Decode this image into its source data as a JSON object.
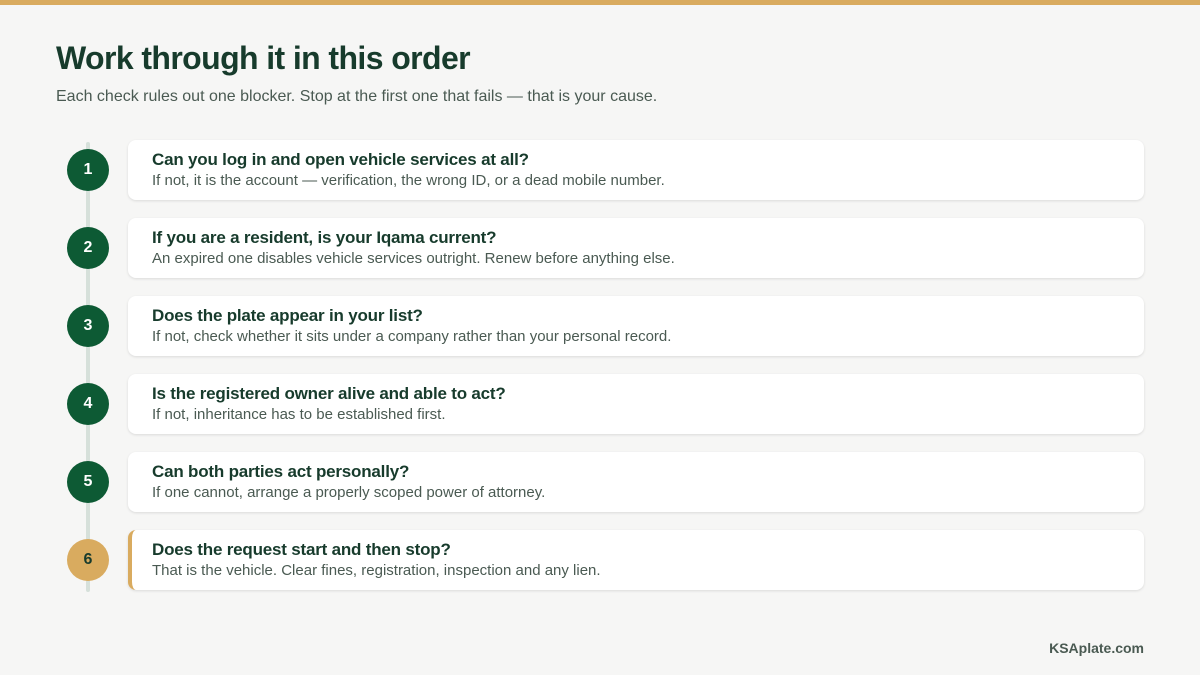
{
  "title": "Work through it in this order",
  "subtitle": "Each check rules out one blocker. Stop at the first one that fails — that is your cause.",
  "steps": [
    {
      "number": "1",
      "question": "Can you log in and open vehicle services at all?",
      "detail": "If not, it is the account — verification, the wrong ID, or a dead mobile number."
    },
    {
      "number": "2",
      "question": "If you are a resident, is your Iqama current?",
      "detail": "An expired one disables vehicle services outright. Renew before anything else."
    },
    {
      "number": "3",
      "question": "Does the plate appear in your list?",
      "detail": "If not, check whether it sits under a company rather than your personal record."
    },
    {
      "number": "4",
      "question": "Is the registered owner alive and able to act?",
      "detail": "If not, inheritance has to be established first."
    },
    {
      "number": "5",
      "question": "Can both parties act personally?",
      "detail": "If one cannot, arrange a properly scoped power of attorney."
    },
    {
      "number": "6",
      "question": "Does the request start and then stop?",
      "detail": "That is the vehicle. Clear fines, registration, inspection and any lien."
    }
  ],
  "brand": "KSAplate.com",
  "colors": {
    "accent": "#d9ab5f",
    "primary": "#0d5a34",
    "heading": "#173b2c",
    "text": "#4a5a52",
    "background": "#f6f6f5"
  }
}
